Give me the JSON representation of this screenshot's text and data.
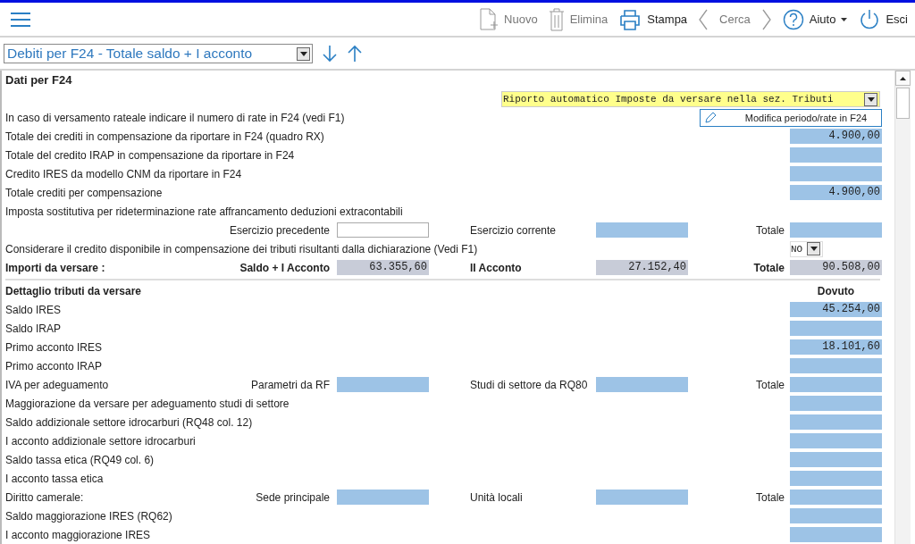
{
  "toolbar": {
    "items": [
      {
        "kind": "new",
        "label": "Nuovo",
        "disabled": true
      },
      {
        "kind": "delete",
        "label": "Elimina",
        "disabled": true
      },
      {
        "kind": "print",
        "label": "Stampa",
        "disabled": false
      },
      {
        "kind": "search",
        "label": "Cerca",
        "disabled": true
      },
      {
        "kind": "help",
        "label": "Aiuto",
        "disabled": false
      },
      {
        "kind": "exit",
        "label": "Esci",
        "disabled": false
      }
    ]
  },
  "selector": {
    "value": "Debiti per F24 - Totale saldo + I acconto"
  },
  "panel": {
    "title": "Dati per F24",
    "mode_select": {
      "value": "Riporto automatico Imposte da versare nella sez. Tributi"
    },
    "rows": [
      {
        "kind": "button",
        "label": "In caso di versamento rateale indicare il numero di rate in F24 (vedi F1)",
        "button": "Modifica periodo/rate in F24"
      },
      {
        "kind": "field",
        "label": "Totale dei crediti in compensazione da riportare in F24 (quadro RX)",
        "field": {
          "kind": "input",
          "value": "4.900,00"
        }
      },
      {
        "kind": "field",
        "label": "Totale del credito IRAP in compensazione da riportare in F24",
        "field": {
          "kind": "input"
        }
      },
      {
        "kind": "field",
        "label": "Credito IRES da modello CNM da riportare in F24",
        "field": {
          "kind": "input"
        }
      },
      {
        "kind": "field",
        "label": "Totale crediti per compensazione",
        "field": {
          "kind": "input",
          "value": "4.900,00"
        }
      },
      {
        "kind": "text",
        "label": "Imposta sostitutiva per rideterminazione rate affrancamento deduzioni extracontabili"
      },
      {
        "kind": "split",
        "bold": false,
        "parts": [
          {
            "label": "Esercizio precedente",
            "field": {
              "kind": "plain"
            }
          },
          {
            "label": "Esercizio corrente",
            "field": {
              "kind": "input"
            }
          },
          {
            "label": "Totale",
            "field": {
              "kind": "input"
            }
          }
        ]
      },
      {
        "kind": "select",
        "label": "Considerare il credito disponibile in compensazione dei tributi risultanti dalla dichiarazione (Vedi F1)",
        "select": "NO"
      },
      {
        "kind": "split",
        "bold": true,
        "label": "Importi da versare :",
        "parts": [
          {
            "label": "Saldo + I Acconto",
            "field": {
              "kind": "computed",
              "value": "63.355,60"
            }
          },
          {
            "label": "II Acconto",
            "field": {
              "kind": "computed",
              "value": "27.152,40"
            }
          },
          {
            "label": "Totale",
            "field": {
              "kind": "computed",
              "value": "90.508,00"
            }
          }
        ]
      }
    ],
    "detail_rows": [
      {
        "kind": "heading",
        "label": "Dettaglio tributi da versare",
        "column": "Dovuto"
      },
      {
        "kind": "field",
        "label": "Saldo IRES",
        "field": {
          "kind": "input",
          "value": "45.254,00"
        }
      },
      {
        "kind": "field",
        "label": "Saldo IRAP",
        "field": {
          "kind": "input"
        }
      },
      {
        "kind": "field",
        "label": "Primo acconto IRES",
        "field": {
          "kind": "input",
          "value": "18.101,60"
        }
      },
      {
        "kind": "field",
        "label": "Primo acconto IRAP",
        "field": {
          "kind": "input"
        }
      },
      {
        "kind": "split",
        "bold": false,
        "label": "IVA per adeguamento",
        "parts": [
          {
            "label": "Parametri da RF",
            "field": {
              "kind": "input"
            }
          },
          {
            "label": "Studi di settore da RQ80",
            "field": {
              "kind": "input"
            }
          },
          {
            "label": "Totale",
            "field": {
              "kind": "input"
            }
          }
        ]
      },
      {
        "kind": "field",
        "label": "Maggiorazione da versare per adeguamento studi di settore",
        "field": {
          "kind": "input"
        }
      },
      {
        "kind": "field",
        "label": "Saldo addizionale settore idrocarburi (RQ48 col. 12)",
        "field": {
          "kind": "input"
        }
      },
      {
        "kind": "field",
        "label": "I acconto addizionale settore idrocarburi",
        "field": {
          "kind": "input"
        }
      },
      {
        "kind": "field",
        "label": "Saldo tassa etica (RQ49 col. 6)",
        "field": {
          "kind": "input"
        }
      },
      {
        "kind": "field",
        "label": "I acconto tassa etica",
        "field": {
          "kind": "input"
        }
      },
      {
        "kind": "split",
        "bold": false,
        "label": "Diritto camerale:",
        "parts": [
          {
            "label": "Sede principale",
            "field": {
              "kind": "input"
            }
          },
          {
            "label": "Unità locali",
            "field": {
              "kind": "input"
            }
          },
          {
            "label": "Totale",
            "field": {
              "kind": "input"
            }
          }
        ]
      },
      {
        "kind": "field",
        "label": "Saldo maggiorazione IRES (RQ62)",
        "field": {
          "kind": "input"
        }
      },
      {
        "kind": "field",
        "label": "I acconto maggiorazione IRES",
        "field": {
          "kind": "input"
        }
      }
    ]
  }
}
